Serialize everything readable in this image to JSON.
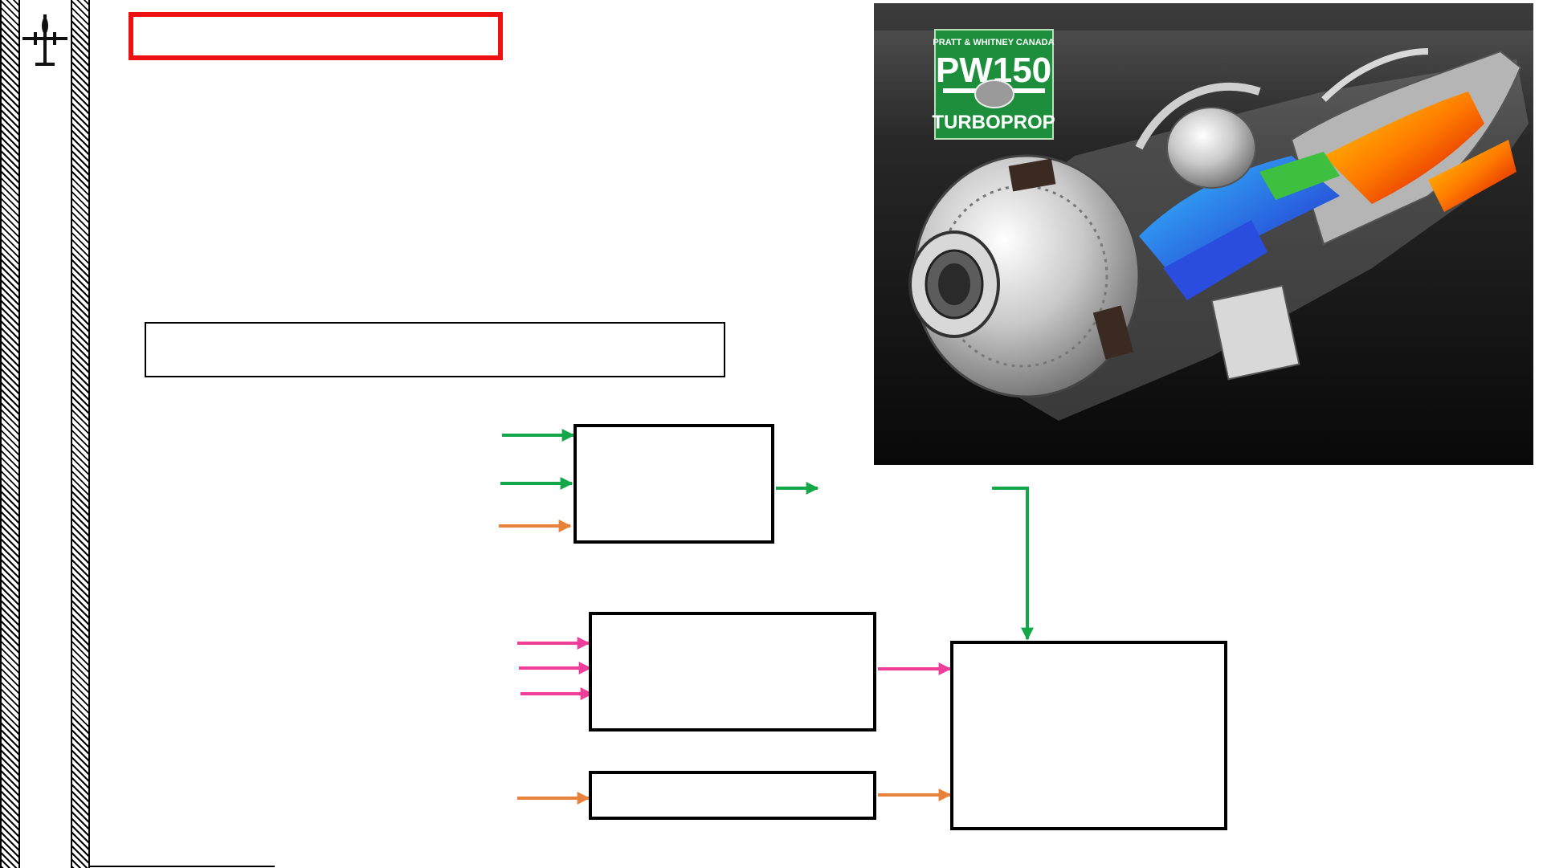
{
  "engine_image": {
    "brand": "PRATT & WHITNEY CANADA",
    "model": "PW150",
    "type": "TURBOPROP"
  },
  "colors": {
    "green_arrow": "#12a84a",
    "orange_arrow": "#e8823a",
    "pink_arrow": "#ee3d9a",
    "title_border": "#ee1111"
  },
  "icons": [
    "aircraft-icon",
    "pratt-whitney-eagle-logo"
  ]
}
